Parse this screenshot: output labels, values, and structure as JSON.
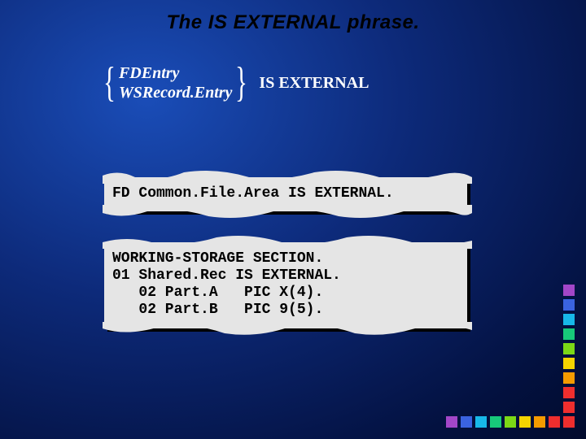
{
  "title": "The IS EXTERNAL phrase.",
  "syntax": {
    "opt1": "FDEntry",
    "opt2": "WSRecord.Entry",
    "keyword": "IS  EXTERNAL"
  },
  "snippet1": "FD Common.File.Area IS EXTERNAL.",
  "snippet2": "WORKING-STORAGE SECTION.\n01 Shared.Rec IS EXTERNAL.\n   02 Part.A   PIC X(4).\n   02 Part.B   PIC 9(5).",
  "colors": {
    "h": [
      "#a346c8",
      "#3a63e0",
      "#17b8e8",
      "#17c97a",
      "#7cd816",
      "#f5d400",
      "#f59b00",
      "#ef2e2e",
      "#ef2e2e"
    ],
    "v": [
      "#a346c8",
      "#3a63e0",
      "#17b8e8",
      "#17c97a",
      "#7cd816",
      "#f5d400",
      "#f59b00",
      "#ef2e2e",
      "#ef2e2e"
    ]
  }
}
